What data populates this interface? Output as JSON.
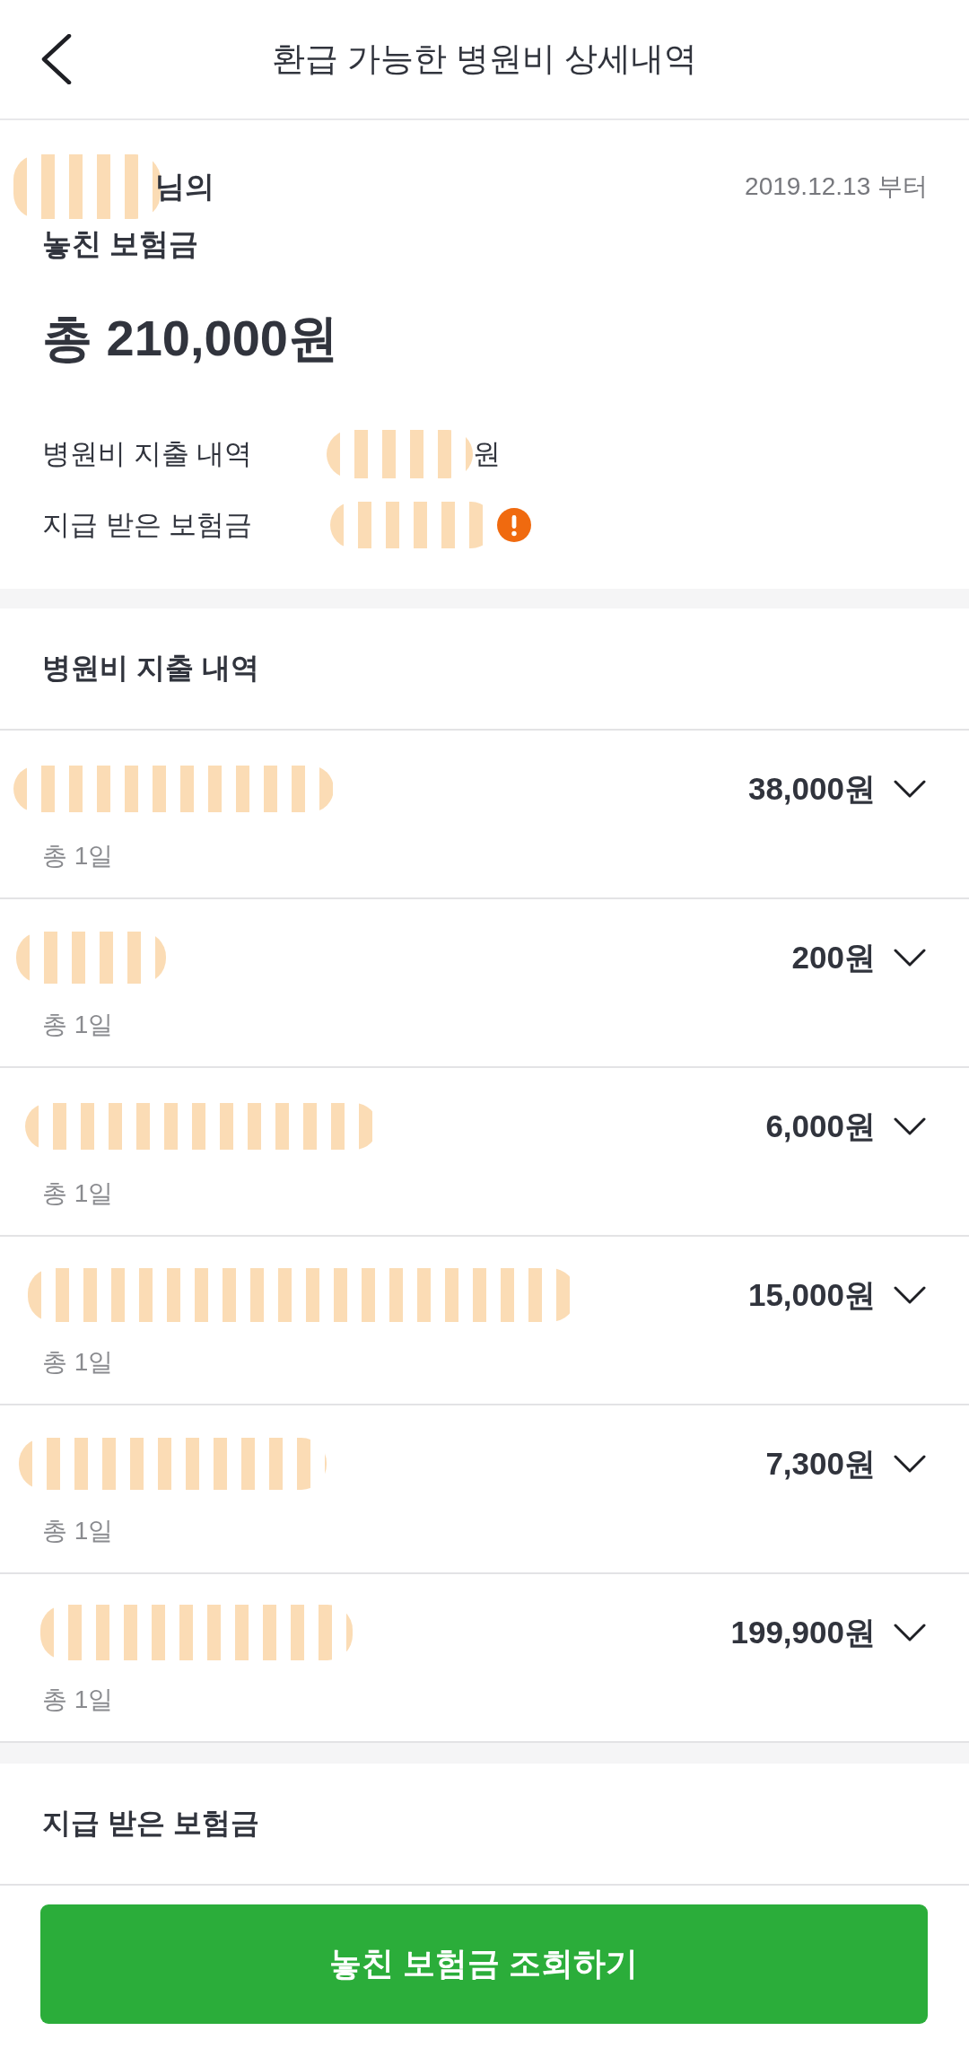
{
  "header": {
    "title": "환급 가능한 병원비 상세내역"
  },
  "summary": {
    "name_redacted": true,
    "name_suffix": "님의",
    "date": "2019.12.13 부터",
    "subtitle": "놓친 보험금",
    "total": "총 210,000원",
    "details": [
      {
        "label": "병원비 지출 내역",
        "value_redacted": true,
        "unit": "원"
      },
      {
        "label": "지급 받은 보험금",
        "value_redacted": true,
        "warning": true
      }
    ]
  },
  "expense_section": {
    "title": "병원비 지출 내역",
    "items": [
      {
        "name_redacted": true,
        "days": "총 1일",
        "amount": "38,000원",
        "expanded": false
      },
      {
        "name_redacted": true,
        "days": "총 1일",
        "amount": "200원",
        "expanded": false
      },
      {
        "name_redacted": true,
        "days": "총 1일",
        "amount": "6,000원",
        "expanded": false
      },
      {
        "name_redacted": true,
        "days": "총 1일",
        "amount": "15,000원",
        "expanded": false
      },
      {
        "name_redacted": true,
        "days": "총 1일",
        "amount": "7,300원",
        "expanded": false
      },
      {
        "name_redacted": true,
        "days": "총 1일",
        "amount": "199,900원",
        "expanded": false
      }
    ]
  },
  "insurance_section": {
    "title": "지급 받은 보험금"
  },
  "button": {
    "label": "놓친 보험금 조회하기"
  }
}
